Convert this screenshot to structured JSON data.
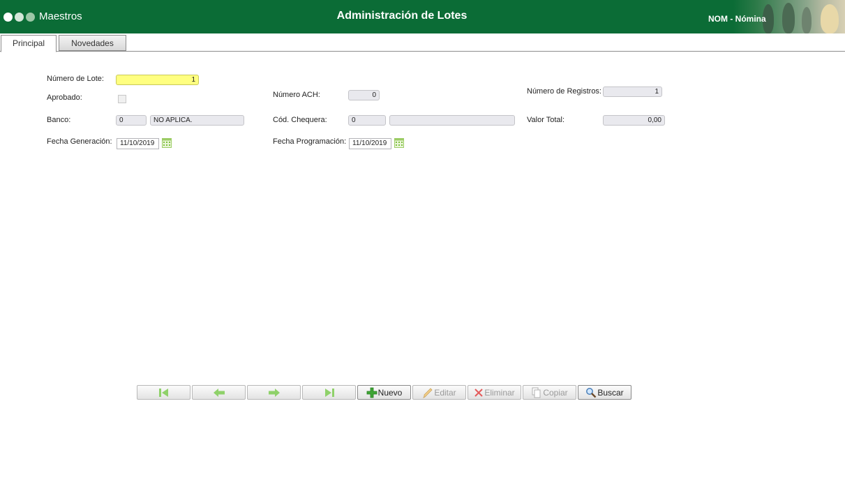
{
  "header": {
    "app_title": "Maestros",
    "page_title": "Administración de Lotes",
    "module_label": "NOM - Nómina",
    "brand_color": "#0b6c36"
  },
  "tabs": [
    {
      "label": "Principal",
      "active": true
    },
    {
      "label": "Novedades",
      "active": false
    }
  ],
  "form": {
    "numero_lote": {
      "label": "Número de Lote:",
      "value": "1"
    },
    "aprobado": {
      "label": "Aprobado:",
      "checked": false
    },
    "banco": {
      "label": "Banco:",
      "code": "0",
      "name": "NO APLICA."
    },
    "fecha_generacion": {
      "label": "Fecha Generación:",
      "value": "11/10/2019"
    },
    "numero_ach": {
      "label": "Número ACH:",
      "value": "0"
    },
    "cod_chequera": {
      "label": "Cód. Chequera:",
      "code": "0",
      "name": ""
    },
    "fecha_programacion": {
      "label": "Fecha Programación:",
      "value": "11/10/2019"
    },
    "numero_registros": {
      "label": "Número de Registros:",
      "value": "1"
    },
    "valor_total": {
      "label": "Valor Total:",
      "value": "0,00"
    }
  },
  "toolbar": {
    "first": {
      "icon": "first-record-icon",
      "enabled": true
    },
    "prev": {
      "icon": "arrow-left-icon",
      "enabled": true
    },
    "next": {
      "icon": "arrow-right-icon",
      "enabled": true
    },
    "last": {
      "icon": "last-record-icon",
      "enabled": true
    },
    "nuevo": {
      "label": "Nuevo",
      "icon": "plus-icon",
      "enabled": true
    },
    "editar": {
      "label": "Editar",
      "icon": "pencil-icon",
      "enabled": false
    },
    "eliminar": {
      "label": "Eliminar",
      "icon": "delete-x-icon",
      "enabled": false
    },
    "copiar": {
      "label": "Copiar",
      "icon": "copy-icon",
      "enabled": false
    },
    "buscar": {
      "label": "Buscar",
      "icon": "magnifier-icon",
      "enabled": true
    }
  }
}
